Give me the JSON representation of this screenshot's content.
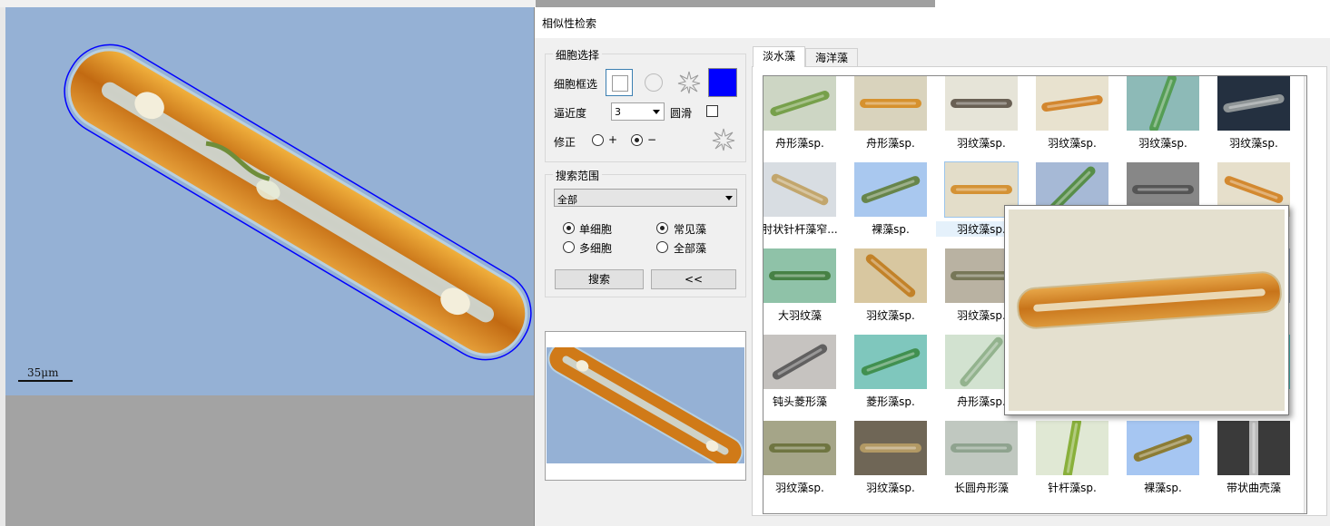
{
  "viewer": {
    "scale_label": "35μm"
  },
  "dialog": {
    "title": "相似性检索",
    "cell_select": {
      "group_title": "细胞选择",
      "box_label": "细胞框选",
      "proximity_label": "逼近度",
      "proximity_value": "3",
      "smooth_label": "圆滑",
      "correct_label": "修正",
      "plus_label": "+",
      "minus_label": "−",
      "color": "#0000ff"
    },
    "search_range": {
      "group_title": "搜索范围",
      "scope_value": "全部",
      "single_cell": "单细胞",
      "multi_cell": "多细胞",
      "common_algae": "常见藻",
      "all_algae": "全部藻",
      "search_button": "搜索",
      "collapse_button": "<<"
    },
    "tabs": [
      {
        "label": "淡水藻",
        "active": true
      },
      {
        "label": "海洋藻",
        "active": false
      }
    ],
    "results": [
      {
        "caption": "舟形藻sp.",
        "bg": "#cdd6c4",
        "cell": "#6e9a3e"
      },
      {
        "caption": "舟形藻sp.",
        "bg": "#d9d3bd",
        "cell": "#d5891e"
      },
      {
        "caption": "羽纹藻sp.",
        "bg": "#e6e4d8",
        "cell": "#5b5146"
      },
      {
        "caption": "羽纹藻sp.",
        "bg": "#e8e2cf",
        "cell": "#d07d1d"
      },
      {
        "caption": "羽纹藻sp.",
        "bg": "#8dbab7",
        "cell": "#4f9a4a"
      },
      {
        "caption": "羽纹藻sp.",
        "bg": "#243040",
        "cell": "#9aa0a0"
      },
      {
        "caption": "肘状针杆藻窄...",
        "bg": "#d8dde2",
        "cell": "#c0a060"
      },
      {
        "caption": "裸藻sp.",
        "bg": "#a9c8ef",
        "cell": "#5f7d38"
      },
      {
        "caption": "羽纹藻sp.",
        "bg": "#e3ddc9",
        "cell": "#d28a25"
      },
      {
        "caption": "",
        "bg": "#a6b9d6",
        "cell": "#4f8a3a"
      },
      {
        "caption": "",
        "bg": "#878787",
        "cell": "#505050"
      },
      {
        "caption": "",
        "bg": "#e6dfcb",
        "cell": "#d0801f"
      },
      {
        "caption": "大羽纹藻",
        "bg": "#8fc2a8",
        "cell": "#3f7a3a"
      },
      {
        "caption": "羽纹藻sp.",
        "bg": "#d8c7a0",
        "cell": "#c07a1c"
      },
      {
        "caption": "羽纹藻sp.",
        "bg": "#b9b2a2",
        "cell": "#707050"
      },
      {
        "caption": "",
        "bg": "#ffffff",
        "cell": "#ffffff"
      },
      {
        "caption": "",
        "bg": "#ffffff",
        "cell": "#ffffff"
      },
      {
        "caption": "",
        "bg": "#a9b9cc",
        "cell": "#8090a0"
      },
      {
        "caption": "钝头菱形藻",
        "bg": "#c6c3c0",
        "cell": "#555555"
      },
      {
        "caption": "菱形藻sp.",
        "bg": "#7fc7bd",
        "cell": "#3b8a44"
      },
      {
        "caption": "舟形藻sp.",
        "bg": "#d2e2d0",
        "cell": "#8cae86"
      },
      {
        "caption": "",
        "bg": "#ffffff",
        "cell": "#ffffff"
      },
      {
        "caption": "",
        "bg": "#ffffff",
        "cell": "#ffffff"
      },
      {
        "caption": "",
        "bg": "#55d8d6",
        "cell": "#2f8f8c"
      },
      {
        "caption": "羽纹藻sp.",
        "bg": "#a5a588",
        "cell": "#69703a"
      },
      {
        "caption": "羽纹藻sp.",
        "bg": "#6f6656",
        "cell": "#b99e66"
      },
      {
        "caption": "长圆舟形藻",
        "bg": "#c0c8c0",
        "cell": "#8a9f8a"
      },
      {
        "caption": "针杆藻sp.",
        "bg": "#e0e8d4",
        "cell": "#7faa2a"
      },
      {
        "caption": "裸藻sp.",
        "bg": "#a6c6f2",
        "cell": "#8a7320"
      },
      {
        "caption": "带状曲壳藻",
        "bg": "#3a3a3a",
        "cell": "#c8c8c8"
      }
    ]
  }
}
